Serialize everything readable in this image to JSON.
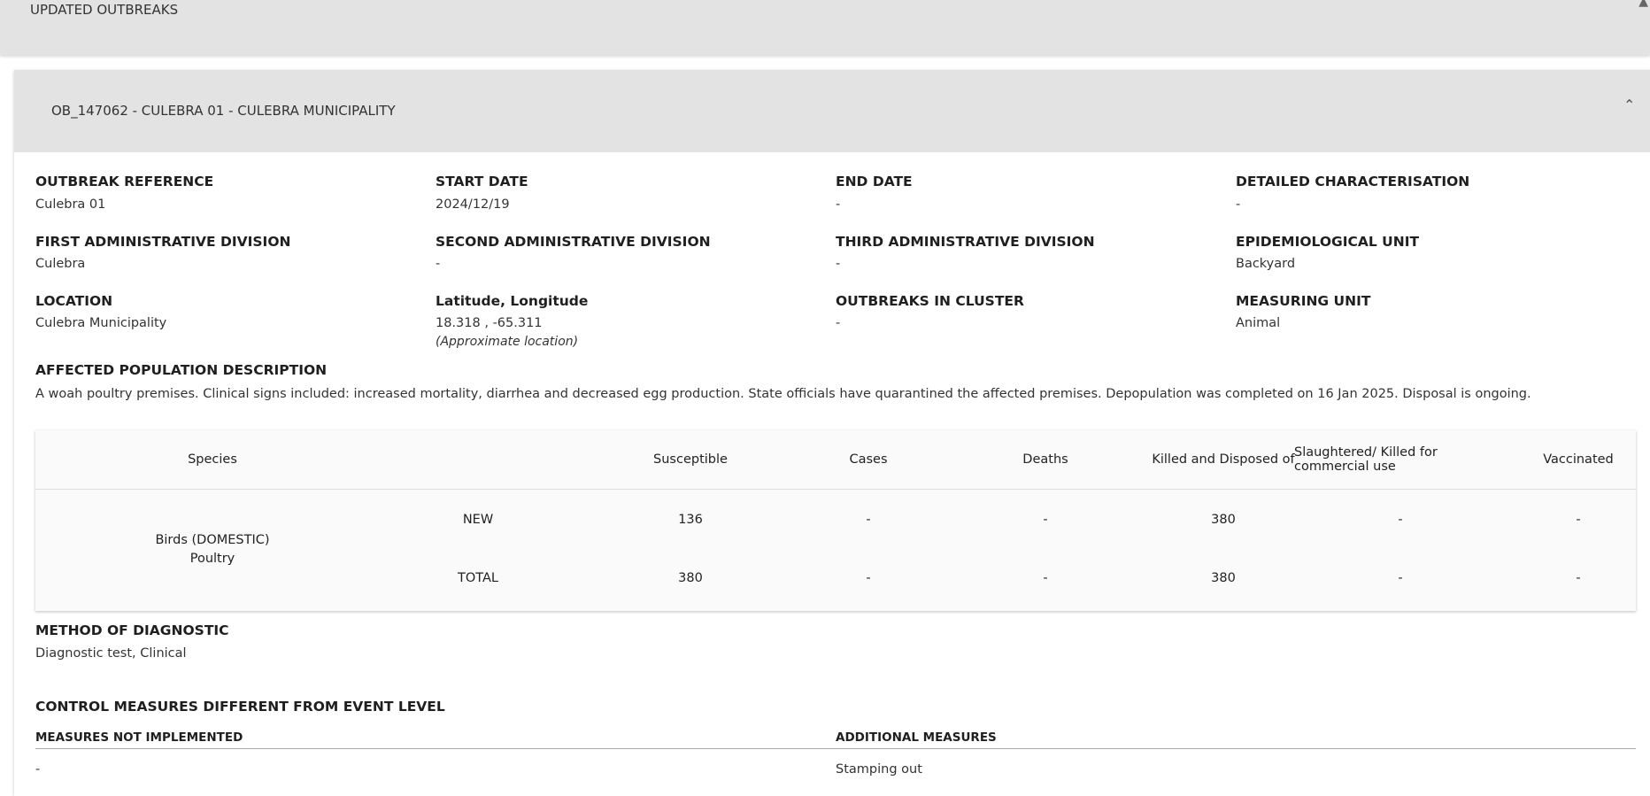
{
  "topbar": {
    "title": "UPDATED OUTBREAKS"
  },
  "outbreak": {
    "header": "OB_147062 - CULEBRA 01 - CULEBRA MUNICIPALITY",
    "fields": [
      {
        "label": "OUTBREAK REFERENCE",
        "value": "Culebra 01"
      },
      {
        "label": "START DATE",
        "value": "2024/12/19"
      },
      {
        "label": "END DATE",
        "value": "-"
      },
      {
        "label": "DETAILED CHARACTERISATION",
        "value": "-"
      },
      {
        "label": "FIRST ADMINISTRATIVE DIVISION",
        "value": "Culebra"
      },
      {
        "label": "SECOND ADMINISTRATIVE DIVISION",
        "value": "-"
      },
      {
        "label": "THIRD ADMINISTRATIVE DIVISION",
        "value": "-"
      },
      {
        "label": "EPIDEMIOLOGICAL UNIT",
        "value": "Backyard"
      },
      {
        "label": "LOCATION",
        "value": "Culebra Municipality"
      },
      {
        "label": "Latitude, Longitude",
        "value": "18.318 , -65.311",
        "note": "(Approximate location)"
      },
      {
        "label": "OUTBREAKS IN CLUSTER",
        "value": "-"
      },
      {
        "label": "MEASURING UNIT",
        "value": "Animal"
      }
    ],
    "affected_population": {
      "label": "AFFECTED POPULATION DESCRIPTION",
      "text": "A woah poultry premises. Clinical signs included: increased mortality, diarrhea and decreased egg production. State officials have quarantined the affected premises. Depopulation was completed on 16 Jan 2025. Disposal is ongoing."
    },
    "table": {
      "headers": [
        "Species",
        "Susceptible",
        "Cases",
        "Deaths",
        "Killed and Disposed of",
        "Slaughtered/ Killed for commercial use",
        "Vaccinated"
      ],
      "species_line1": "Birds (DOMESTIC)",
      "species_line2": "Poultry",
      "rows": [
        {
          "label": "NEW",
          "values": [
            "136",
            "-",
            "-",
            "380",
            "-",
            "-"
          ]
        },
        {
          "label": "TOTAL",
          "values": [
            "380",
            "-",
            "-",
            "380",
            "-",
            "-"
          ]
        }
      ]
    },
    "diagnostic": {
      "label": "METHOD OF DIAGNOSTIC",
      "value": "Diagnostic test, Clinical"
    },
    "control": {
      "label": "CONTROL MEASURES DIFFERENT FROM EVENT LEVEL",
      "not_implemented_label": "MEASURES NOT IMPLEMENTED",
      "not_implemented_value": "-",
      "additional_label": "ADDITIONAL MEASURES",
      "additional_value": "Stamping out"
    }
  }
}
